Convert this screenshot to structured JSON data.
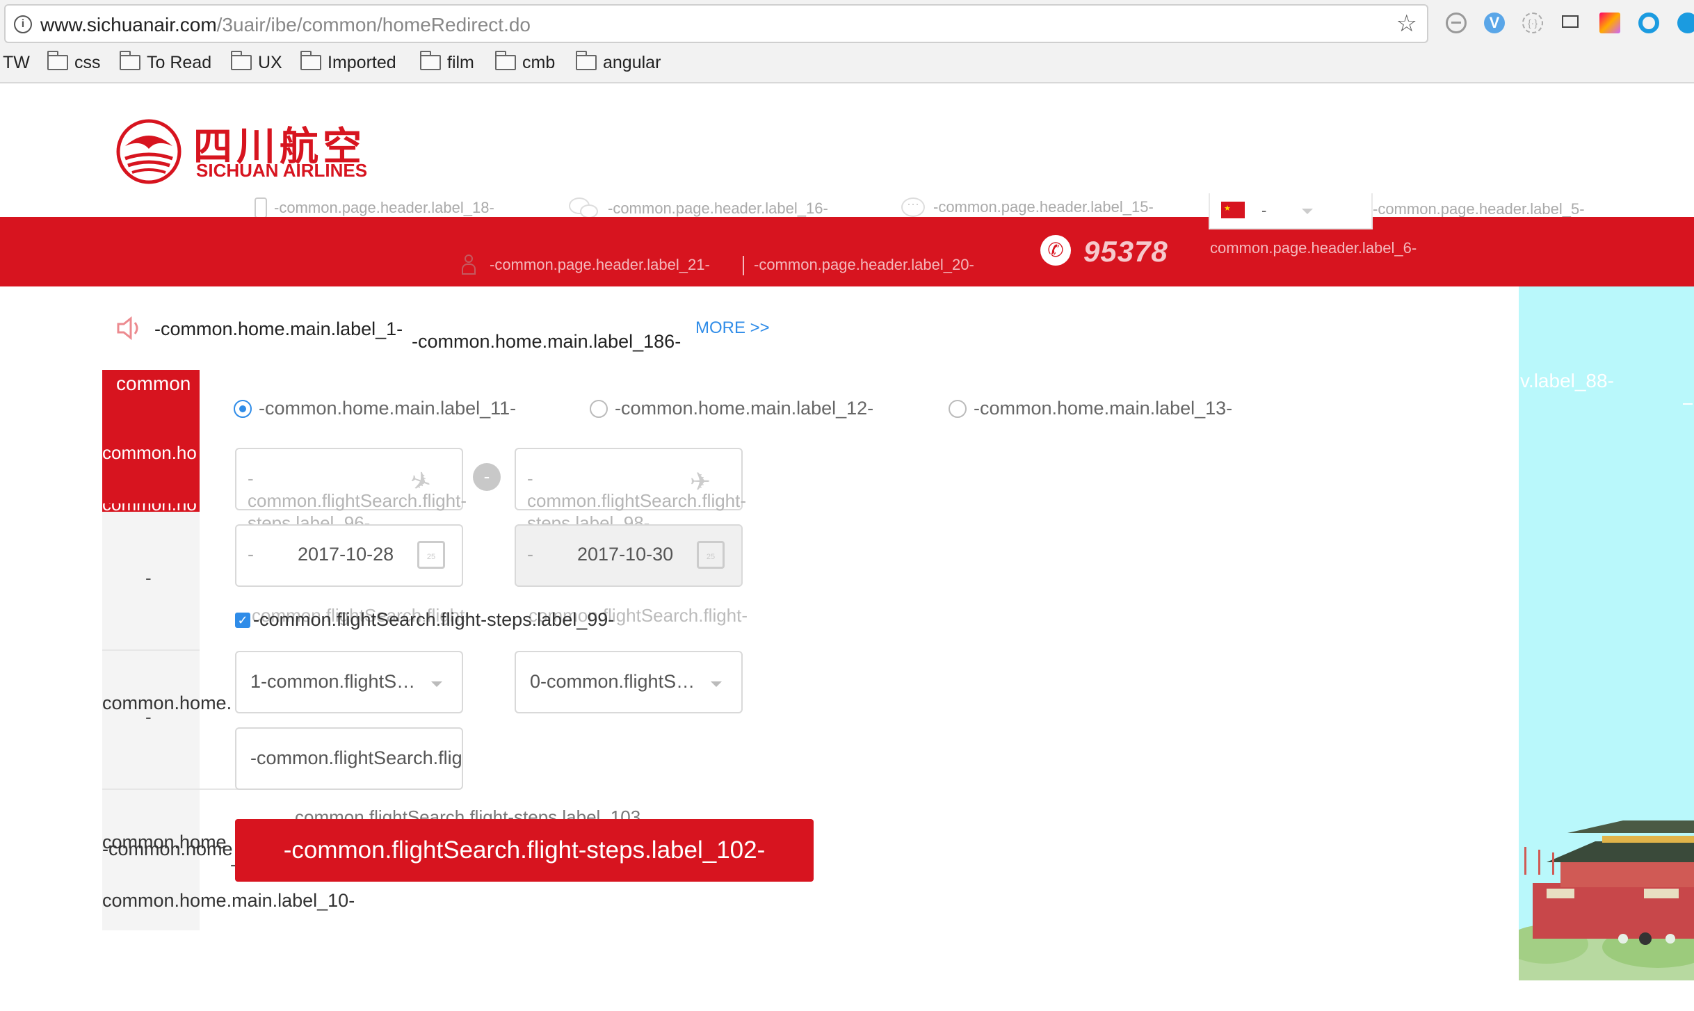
{
  "browser": {
    "url_host": "www.sichuanair.com",
    "url_path": "/3uair/ibe/common/homeRedirect.do",
    "bookmarks": [
      {
        "label": "TW",
        "folder": false
      },
      {
        "label": "css",
        "folder": true
      },
      {
        "label": "To Read",
        "folder": true
      },
      {
        "label": "UX",
        "folder": true
      },
      {
        "label": "Imported",
        "folder": true
      },
      {
        "label": "film",
        "folder": true
      },
      {
        "label": "cmb",
        "folder": true
      },
      {
        "label": "angular",
        "folder": true
      }
    ]
  },
  "logo": {
    "chinese": "四川航空",
    "english": "SICHUAN AIRLINES"
  },
  "header": {
    "top_links": [
      {
        "label": "-common.page.header.label_18-",
        "icon": "mobile-icon"
      },
      {
        "label": "-common.page.header.label_16-",
        "icon": "wechat-icon"
      },
      {
        "label": "-common.page.header.label_15-",
        "icon": "chat-icon"
      }
    ],
    "language_value": "-",
    "top_right_link": "-common.page.header.label_5-",
    "login_link": "-common.page.header.label_21-",
    "register_link": "-common.page.header.label_20-",
    "hotline": "95378",
    "hotline_label": "common.page.header.label_6-"
  },
  "notice": {
    "label": "-common.home.main.label_1-",
    "text": "-common.home.main.label_186-",
    "more": "MORE >>"
  },
  "left_tabs": {
    "tab1": "common",
    "tab2": "common.ho",
    "tab3": "common.ho",
    "tab4": "-",
    "tab5": "common.home.",
    "tab5_sub": "-",
    "tab6_a": "common.home",
    "tab6_b": "-common.home",
    "tab6_sub": "-",
    "tab7": "common.home.main.label_10-"
  },
  "trip_type": {
    "options": [
      {
        "label": "-common.home.main.label_11-",
        "selected": true
      },
      {
        "label": "-common.home.main.label_12-",
        "selected": false
      },
      {
        "label": "-common.home.main.label_13-",
        "selected": false
      }
    ]
  },
  "form": {
    "from_placeholder": "-\ncommon.flightSearch.flight-steps.label_96-",
    "to_placeholder": "-\ncommon.flightSearch.flight-steps.label_98-",
    "depart_prefix": "-",
    "depart_date": "2017-10-28",
    "return_prefix": "-",
    "return_date": "2017-10-30",
    "checkbox_label": "-common.flightSearch.flight-steps.label_99-",
    "overlap_left": "common.flightSearch.flight-",
    "overlap_right": "common.flightSearch.flight-",
    "adults_value": "1-common.flightS…",
    "children_value": "0-common.flightS…",
    "promo_value": "-common.flightSearch.flig",
    "hint_text": "common.flightSearch.flight-steps.label_103",
    "search_button": "-common.flightSearch.flight-steps.label_102-"
  },
  "banner": {
    "label": "v.label_88-"
  },
  "colors": {
    "brand_red": "#d7141f",
    "link_blue": "#2f8ce8",
    "banner_sky": "#b9f8fb"
  }
}
